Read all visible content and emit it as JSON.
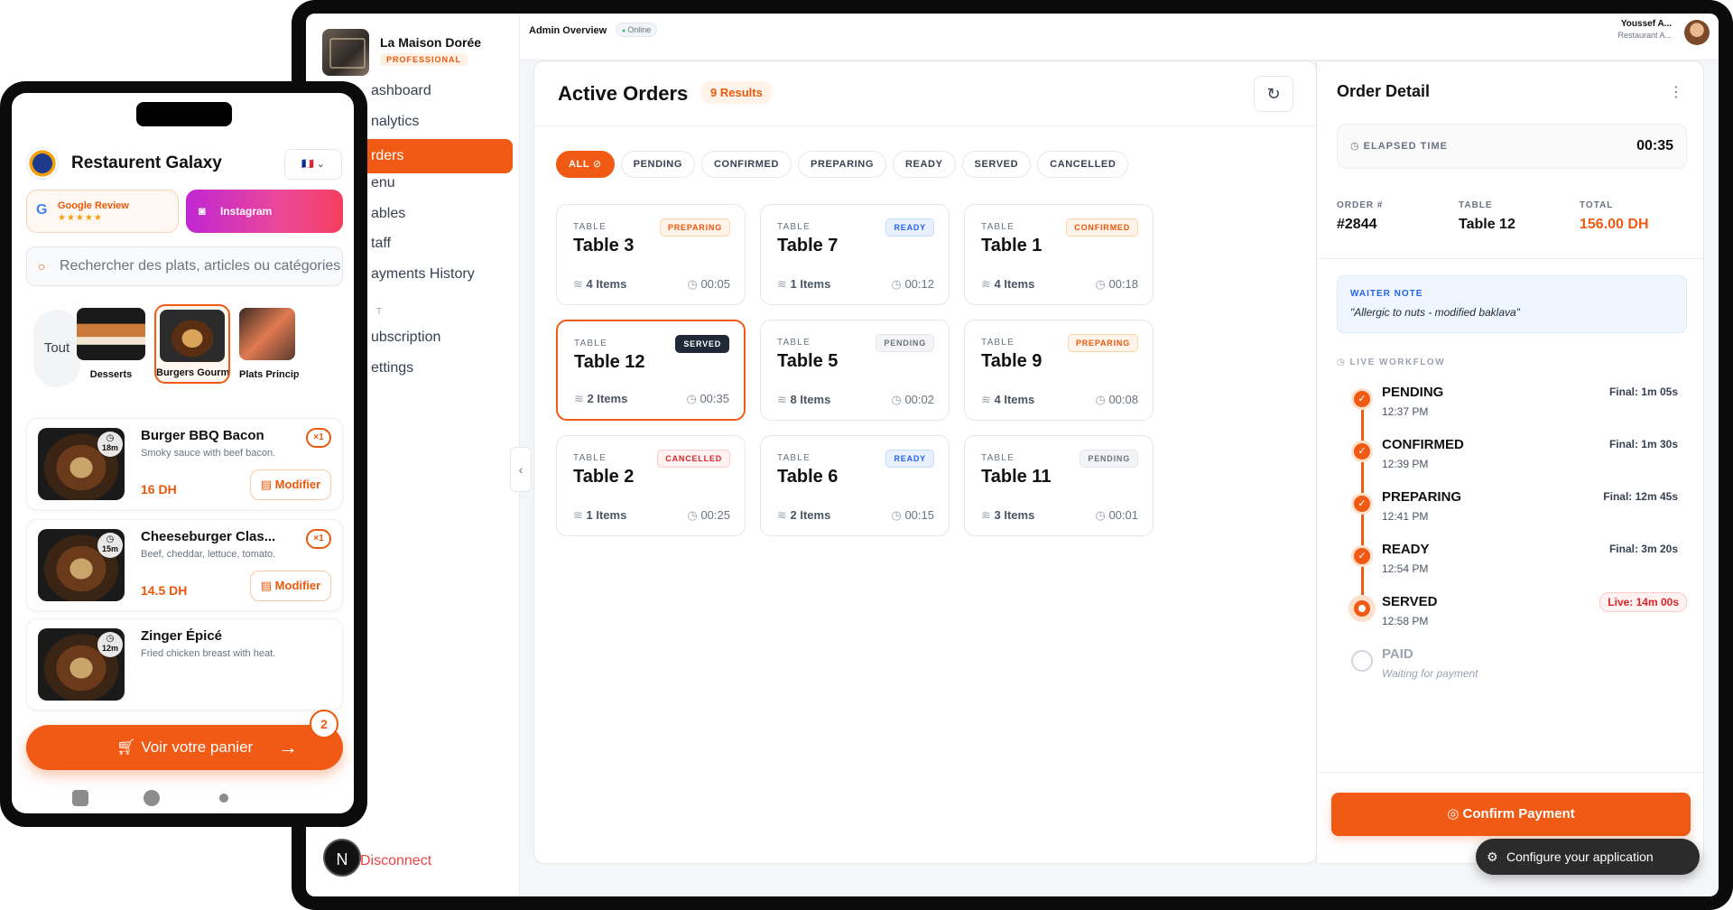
{
  "admin": {
    "brand": {
      "name": "La Maison Dorée",
      "badge": "PROFESSIONAL"
    },
    "nav": [
      {
        "label": "Dashboard",
        "visible": "ashboard"
      },
      {
        "label": "Analytics",
        "visible": "nalytics"
      },
      {
        "label": "Orders",
        "visible": "rders",
        "active": true
      },
      {
        "label": "Menu",
        "visible": "enu"
      },
      {
        "label": "Tables",
        "visible": "ables"
      },
      {
        "label": "Staff",
        "visible": "taff"
      },
      {
        "label": "Payments History",
        "visible": "ayments History"
      }
    ],
    "nav_section": "T",
    "nav_bottom": [
      {
        "label": "Subscription",
        "visible": "ubscription"
      },
      {
        "label": "Settings",
        "visible": "ettings"
      }
    ],
    "disconnect": "Disconnect",
    "collapse_icon": "chevron-left-icon",
    "avatar_letter": "N",
    "topbar": {
      "title": "Admin Overview",
      "status": "Online",
      "user_name": "Youssef A...",
      "user_role": "Restaurant A..."
    },
    "orders": {
      "title": "Active Orders",
      "count": "9 Results",
      "filters": [
        "ALL",
        "PENDING",
        "CONFIRMED",
        "PREPARING",
        "READY",
        "SERVED",
        "CANCELLED"
      ],
      "active_filter": "ALL",
      "cards": [
        {
          "label": "TABLE",
          "table": "Table 3",
          "status": "PREPARING",
          "items": "4 Items",
          "time": "00:05"
        },
        {
          "label": "TABLE",
          "table": "Table 7",
          "status": "READY",
          "items": "1 Items",
          "time": "00:12"
        },
        {
          "label": "TABLE",
          "table": "Table 1",
          "status": "CONFIRMED",
          "items": "4 Items",
          "time": "00:18"
        },
        {
          "label": "TABLE",
          "table": "Table 12",
          "status": "SERVED",
          "items": "2 Items",
          "time": "00:35",
          "selected": true
        },
        {
          "label": "TABLE",
          "table": "Table 5",
          "status": "PENDING",
          "items": "8 Items",
          "time": "00:02"
        },
        {
          "label": "TABLE",
          "table": "Table 9",
          "status": "PREPARING",
          "items": "4 Items",
          "time": "00:08"
        },
        {
          "label": "TABLE",
          "table": "Table 2",
          "status": "CANCELLED",
          "items": "1 Items",
          "time": "00:25"
        },
        {
          "label": "TABLE",
          "table": "Table 6",
          "status": "READY",
          "items": "2 Items",
          "time": "00:15"
        },
        {
          "label": "TABLE",
          "table": "Table 11",
          "status": "PENDING",
          "items": "3 Items",
          "time": "00:01"
        }
      ]
    },
    "detail": {
      "title": "Order Detail",
      "elapsed_label": "ELAPSED TIME",
      "elapsed_value": "00:35",
      "order_label": "ORDER #",
      "order_value": "#2844",
      "table_label": "TABLE",
      "table_value": "Table 12",
      "total_label": "TOTAL",
      "total_value": "156.00 DH",
      "note_title": "WAITER NOTE",
      "note_text": "\"Allergic to nuts - modified baklava\"",
      "workflow_title": "LIVE WORKFLOW",
      "workflow": [
        {
          "name": "PENDING",
          "time": "12:37 PM",
          "duration": "Final: 1m 05s",
          "state": "done"
        },
        {
          "name": "CONFIRMED",
          "time": "12:39 PM",
          "duration": "Final: 1m 30s",
          "state": "done"
        },
        {
          "name": "PREPARING",
          "time": "12:41 PM",
          "duration": "Final: 12m 45s",
          "state": "done"
        },
        {
          "name": "READY",
          "time": "12:54 PM",
          "duration": "Final: 3m 20s",
          "state": "done"
        },
        {
          "name": "SERVED",
          "time": "12:58 PM",
          "duration": "Live: 14m 00s",
          "state": "live"
        },
        {
          "name": "PAID",
          "time": "Waiting for payment",
          "duration": "",
          "state": "pending"
        }
      ],
      "confirm": "Confirm Payment"
    },
    "configure": "Configure your application"
  },
  "mobile": {
    "restaurant": "Restaurent Galaxy",
    "language_flag": "🇫🇷",
    "google_label": "Google Review",
    "google_stars": "★★★★★",
    "instagram_label": "Instagram",
    "search_placeholder": "Rechercher des plats, articles ou catégories",
    "categories": [
      {
        "label": "Tout"
      },
      {
        "label": "Desserts"
      },
      {
        "label": "Burgers Gourmet",
        "active": true
      },
      {
        "label": "Plats Principaux"
      }
    ],
    "items": [
      {
        "name": "Burger BBQ Bacon",
        "desc": "Smoky sauce with beef bacon.",
        "price": "16 DH",
        "prep": "18m",
        "qty": "×1",
        "action": "Modifier"
      },
      {
        "name": "Cheeseburger Clas...",
        "desc": "Beef, cheddar, lettuce, tomato.",
        "price": "14.5 DH",
        "prep": "15m",
        "qty": "×1",
        "action": "Modifier"
      },
      {
        "name": "Zinger Épicé",
        "desc": "Fried chicken breast with heat.",
        "price": "",
        "prep": "12m",
        "qty": "",
        "action": ""
      }
    ],
    "cart_label": "Voir votre panier",
    "cart_count": "2"
  }
}
